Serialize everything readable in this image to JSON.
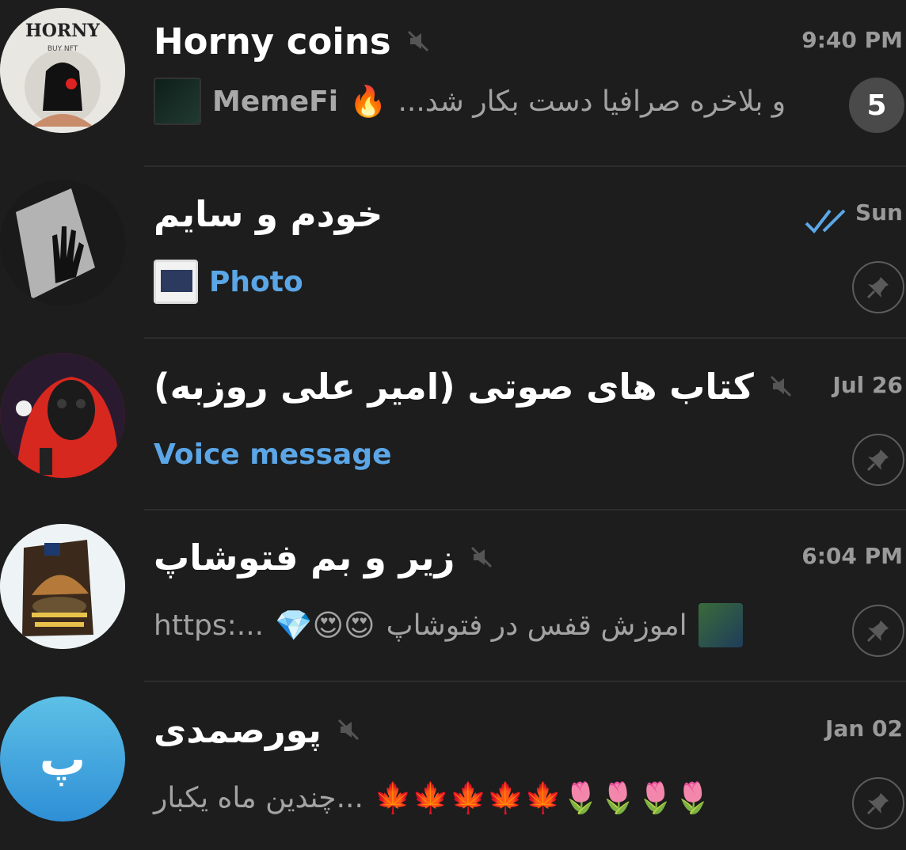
{
  "chats": [
    {
      "title": "Horny coins",
      "time": "9:40 PM",
      "sender": "MemeFi",
      "preview": "...و بلاخره صرافیا دست بکار شد",
      "preview_emoji": "🔥",
      "unread": "5",
      "muted": true,
      "avatar_text_top": "HORNY",
      "avatar_text_sub": "BUY NFT"
    },
    {
      "title": "خودم و سایم",
      "time": "Sun",
      "preview": "Photo",
      "read_receipt": "double-check",
      "pinned": true
    },
    {
      "title": "کتاب های صوتی (امیر علی روزبه)",
      "time": "Jul 26",
      "preview": "Voice message",
      "muted": true,
      "pinned": true
    },
    {
      "title": "زیر و بم فتوشاپ",
      "time": "6:04 PM",
      "preview": "اموزش قفس در فتوشاپ",
      "preview_emoji": "💎😍😍",
      "preview_suffix": "https:...",
      "muted": true,
      "pinned": true
    },
    {
      "title": "پورصمدی",
      "time": "Jan 02",
      "preview": "چندین ماه یکبار...",
      "preview_emoji": "🍁🍁🍁🍁🍁🌷🌷🌷🌷",
      "avatar_letter": "پ",
      "muted": true,
      "pinned": true
    }
  ],
  "colors": {
    "background": "#1d1d1d",
    "accent_blue": "#5ba6e6",
    "badge_bg": "#4a4a4a",
    "secondary_text": "#9a9a9a"
  }
}
